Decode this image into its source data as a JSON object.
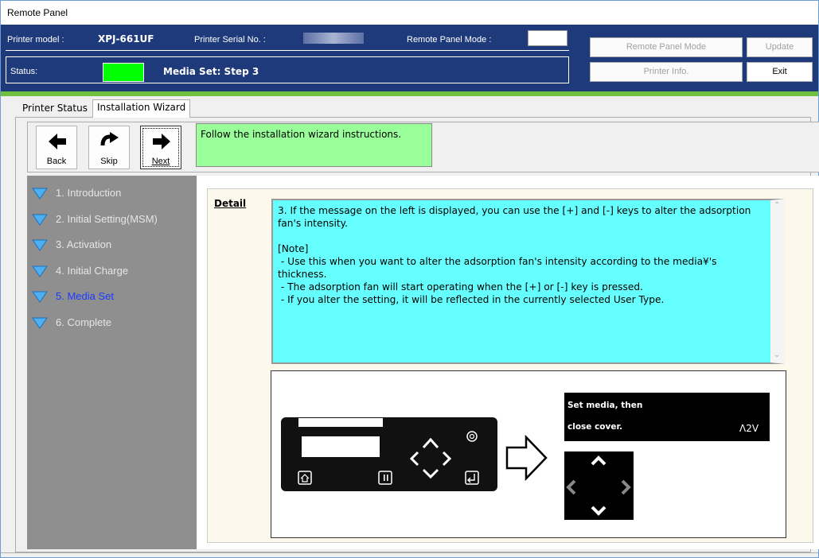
{
  "window": {
    "title": "Remote Panel"
  },
  "header": {
    "model_label": "Printer model :",
    "model_value": "XPJ-661UF",
    "serial_label": "Printer Serial No. :",
    "mode_label": "Remote Panel Mode :",
    "status_label": "Status:",
    "status_value": "Media Set: Step 3",
    "status_color": "#00ff00",
    "buttons": {
      "remote_panel_mode": "Remote Panel Mode",
      "update": "Update",
      "printer_info": "Printer Info.",
      "exit": "Exit"
    }
  },
  "tabs": [
    {
      "label": "Printer Status"
    },
    {
      "label": "Installation Wizard"
    }
  ],
  "toolbar": {
    "back": "Back",
    "skip": "Skip",
    "next": "Next",
    "instructions": "Follow the installation wizard instructions."
  },
  "steps": [
    {
      "label": "1. Introduction"
    },
    {
      "label": "2. Initial Setting(MSM)"
    },
    {
      "label": "3. Activation"
    },
    {
      "label": "4. Initial Charge"
    },
    {
      "label": "5. Media Set"
    },
    {
      "label": "6. Complete"
    }
  ],
  "current_step": 5,
  "detail": {
    "label": "Detail",
    "text": "3. If the message on the left is displayed, you can use the [+] and [-] keys to alter the adsorption fan's intensity.\n\n[Note]\n - Use this when you want to alter the adsorption fan's intensity according to the media¥'s thickness.\n - The adsorption fan will start operating when the [+] or [-] key is pressed.\n - If you alter the setting, it will be reflected in the currently selected User Type."
  },
  "illustration": {
    "lcd_line1": "Set media, then",
    "lcd_line2": "close cover.",
    "lcd_code": "Λ2V"
  },
  "colors": {
    "header_bg": "#1f3a7a",
    "accent_strip": "#6fbf40",
    "instructions_bg": "#99ff99",
    "detail_bg": "#66ffff"
  }
}
